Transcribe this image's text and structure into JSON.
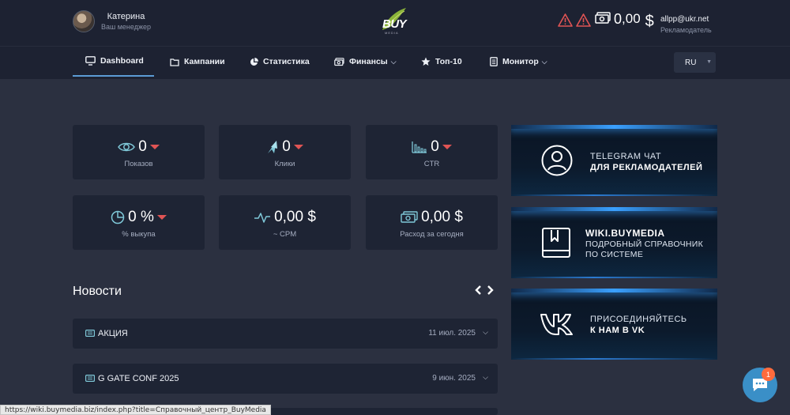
{
  "header": {
    "manager_name": "Катерина",
    "manager_role": "Ваш менеджер",
    "logo_text": "BUY",
    "logo_sub": "MEDIA",
    "balance_value": "0",
    "balance_sup": ",00",
    "balance_currency": "$",
    "user_email": "allpp@ukr.net",
    "user_role": "Рекламодатель"
  },
  "nav": {
    "dashboard": "Dashboard",
    "campaigns": "Кампании",
    "stats": "Статистика",
    "finance": "Финансы",
    "top10": "Топ-10",
    "monitor": "Монитор",
    "lang": "RU"
  },
  "stats": [
    {
      "value": "0",
      "label": "Показов"
    },
    {
      "value": "0",
      "label": "Клики"
    },
    {
      "value": "0",
      "label": "CTR"
    },
    {
      "value": "0 %",
      "label": "% выкупа"
    },
    {
      "value": "0,00 $",
      "label": "~ CPM"
    },
    {
      "value": "0,00 $",
      "label": "Расход за сегодня"
    }
  ],
  "promos": {
    "telegram_line1": "TELEGRAM ЧАТ",
    "telegram_line2": "ДЛЯ РЕКЛАМОДАТЕЛЕЙ",
    "wiki_title": "WIKI.BUYMEDIA",
    "wiki_sub1": "ПОДРОБНЫЙ СПРАВОЧНИК",
    "wiki_sub2": "ПО СИСТЕМЕ",
    "vk_line1": "ПРИСОЕДИНЯЙТЕСЬ",
    "vk_line2": "К НАМ В VK"
  },
  "news": {
    "title": "Новости",
    "items": [
      {
        "name": "АКЦИЯ",
        "date": "11 июл. 2025"
      },
      {
        "name": "G GATE CONF 2025",
        "date": "9 июн. 2025"
      }
    ]
  },
  "status_url": "https://wiki.buymedia.biz/index.php?title=Справочный_центр_BuyMedia",
  "chat_badge": "1",
  "colors": {
    "background": "#2b3040",
    "panel": "#1e2434",
    "accent": "#5b9bd5",
    "alert": "#e05454",
    "chat": "#3a8fc7"
  }
}
